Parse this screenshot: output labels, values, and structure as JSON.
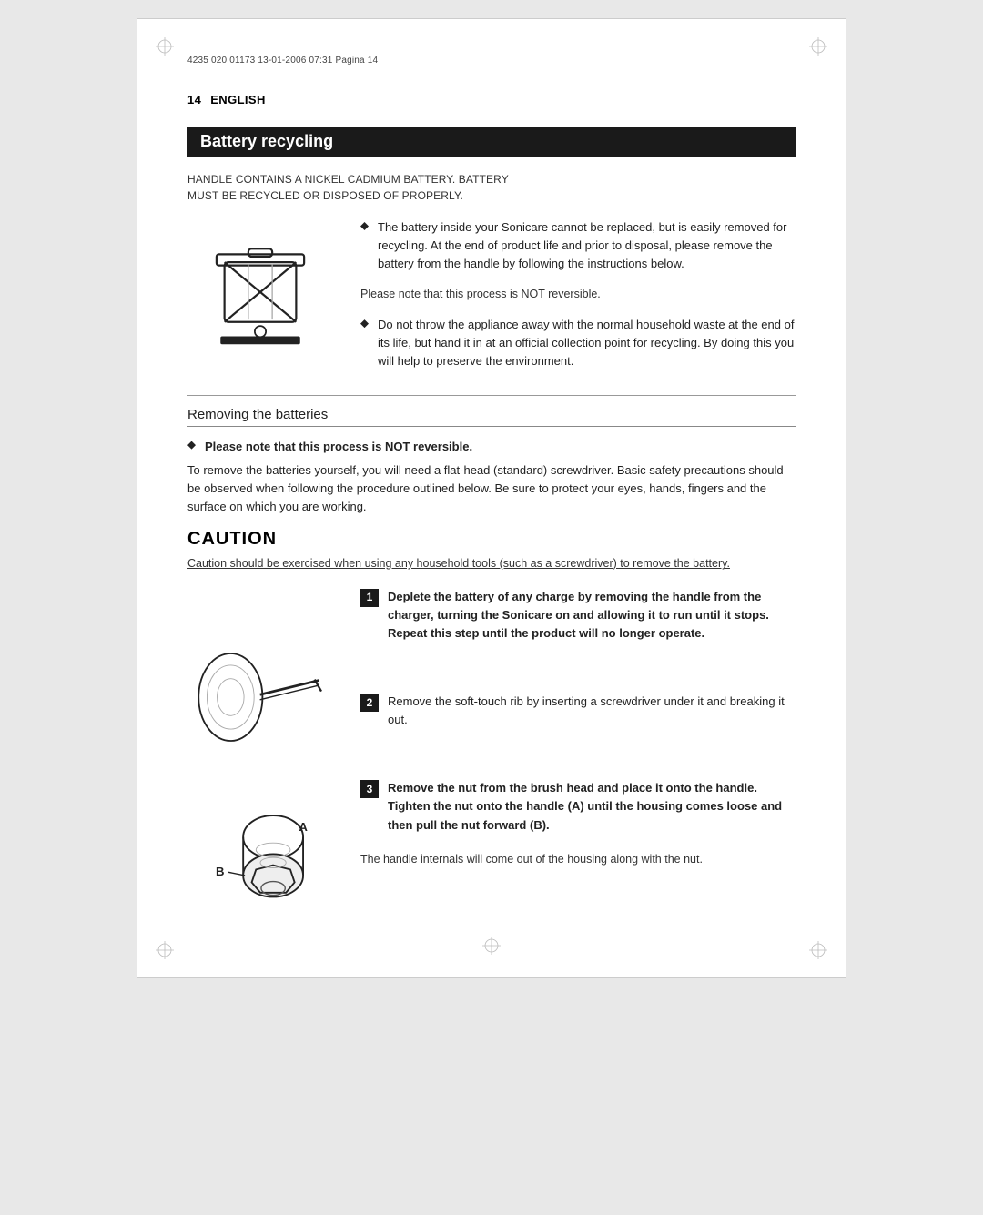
{
  "header": {
    "text": "4235 020 01173  13-01-2006  07:31  Pagina 14"
  },
  "page_number": "14",
  "section_label": "ENGLISH",
  "section_title": "Battery recycling",
  "warning": {
    "line1": "HANDLE CONTAINS A NICKEL CADMIUM BATTERY. BATTERY",
    "line2": "MUST BE RECYCLED OR DISPOSED OF PROPERLY."
  },
  "bullet1": {
    "text": "The battery inside your Sonicare cannot be replaced, but is easily removed for recycling. At the end of product life and prior to disposal, please remove the battery from the handle by following the instructions below."
  },
  "note1": "Please note that this process is NOT reversible.",
  "bullet2": {
    "text": "Do not throw the appliance away with the normal household waste at the end of its life, but hand it in at an official collection point for recycling. By doing this you will help to preserve the environment."
  },
  "subheading": "Removing the batteries",
  "bullet3": {
    "text_bold": "Please note that this process is NOT reversible.",
    "text": "To remove the batteries yourself, you will need a flat-head (standard) screwdriver. Basic safety precautions should be observed when following the procedure outlined below. Be sure to protect your eyes, hands, fingers and the surface on which you are working."
  },
  "caution_heading": "CAUTION",
  "caution_text": "Caution should be exercised when using any household tools (such as a screwdriver) to remove the battery.",
  "step1": {
    "number": "1",
    "text_bold": "Deplete the battery of any charge by removing the handle from the charger, turning the Sonicare on and allowing it to run until it stops. Repeat this step until the product will no longer operate."
  },
  "step2": {
    "number": "2",
    "text": "Remove the soft-touch rib by inserting a screwdriver under it and breaking it out."
  },
  "step3": {
    "number": "3",
    "text_bold": "Remove the nut from the brush head and place it onto the handle. Tighten the nut onto the handle (A) until the housing comes loose and then pull the nut forward (B)."
  },
  "step3_note": "The handle internals will come out of the housing along with the nut."
}
